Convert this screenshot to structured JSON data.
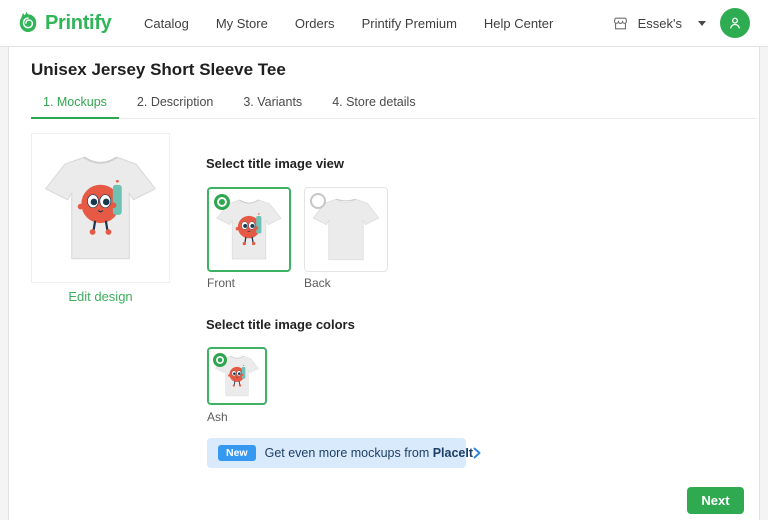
{
  "brand": {
    "name": "Printify"
  },
  "header": {
    "nav": [
      "Catalog",
      "My Store",
      "Orders",
      "Printify Premium",
      "Help Center"
    ],
    "store_name": "Essek's"
  },
  "page": {
    "title": "Unisex Jersey Short Sleeve Tee",
    "tabs": [
      {
        "label": "1. Mockups",
        "active": true
      },
      {
        "label": "2. Description",
        "active": false
      },
      {
        "label": "3. Variants",
        "active": false
      },
      {
        "label": "4. Store details",
        "active": false
      }
    ],
    "edit_design_label": "Edit design",
    "view_section": {
      "heading": "Select title image view",
      "options": [
        {
          "label": "Front",
          "selected": true
        },
        {
          "label": "Back",
          "selected": false
        }
      ]
    },
    "colors_section": {
      "heading": "Select title image colors",
      "options": [
        {
          "label": "Ash",
          "selected": true
        }
      ]
    },
    "placeit_banner": {
      "badge": "New",
      "text_before": "Get even more mockups from ",
      "brand": "PlaceIt"
    },
    "next_button_label": "Next"
  },
  "colors": {
    "brand_green": "#31b559",
    "active_tab_green": "#2fa64e",
    "selected_border_green": "#3db263",
    "next_button_green": "#2faa50",
    "avatar_green": "#2eac52",
    "edit_link_green": "#3fae5f",
    "banner_bg_blue": "#d9eafc",
    "banner_badge_blue": "#3599f2",
    "banner_text_navy": "#1d3f66",
    "tee_red": "#e65a45",
    "tee_marker_teal": "#6ec2b4"
  }
}
